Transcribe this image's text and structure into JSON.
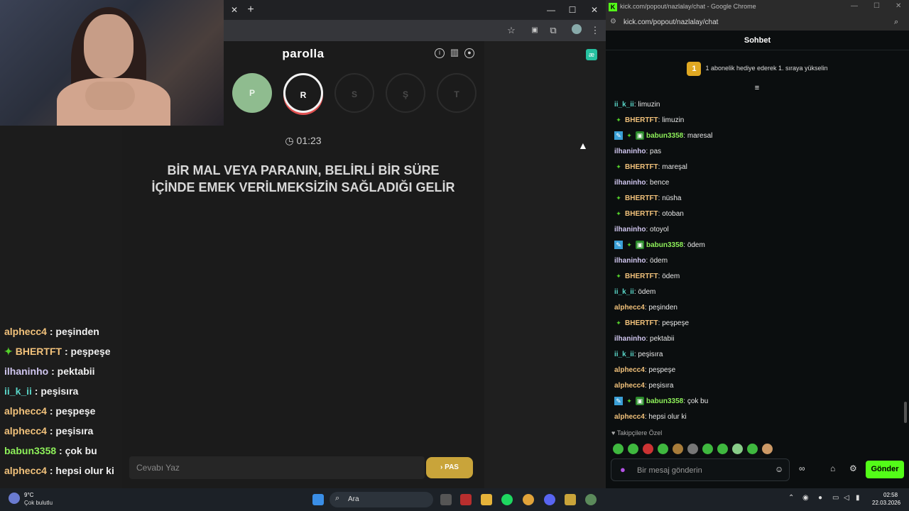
{
  "left_window": {
    "new_tab_symbol": "+",
    "controls": {
      "minimize": "—",
      "maximize": "☐",
      "close": "✕"
    }
  },
  "game": {
    "title": "parolla",
    "letters": [
      {
        "char": "P",
        "state": "done"
      },
      {
        "char": "R",
        "state": "active"
      },
      {
        "char": "S",
        "state": "pending"
      },
      {
        "char": "Ş",
        "state": "pending"
      },
      {
        "char": "T",
        "state": "pending"
      }
    ],
    "timer": "01:23",
    "question": "BİR MAL VEYA PARANIN, BELİRLİ BİR SÜRE İÇİNDE EMEK VERİLMEKSİZİN SAĞLADIĞI GELİR",
    "answer_placeholder": "Cevabı Yaz",
    "pas_label": "PAS"
  },
  "overlay_chat": [
    {
      "user": "alphecc4",
      "text": "peşinden",
      "color": "#f2c27b"
    },
    {
      "user": "BHERTFT",
      "text": "peşpeşe",
      "color": "#f2c27b",
      "badge": "✦"
    },
    {
      "user": "ilhaninho",
      "text": "pektabii",
      "color": "#d0c6ef"
    },
    {
      "user": "ii_k_ii",
      "text": "peşisıra",
      "color": "#5ad6c8"
    },
    {
      "user": "alphecc4",
      "text": "peşpeşe",
      "color": "#f2c27b"
    },
    {
      "user": "alphecc4",
      "text": "peşisıra",
      "color": "#f2c27b"
    },
    {
      "user": "babun3358",
      "text": "çok bu",
      "color": "#8ef05a"
    },
    {
      "user": "alphecc4",
      "text": "hepsi olur ki",
      "color": "#f2c27b"
    }
  ],
  "popup": {
    "window_title": "kick.com/popout/nazlalay/chat - Google Chrome",
    "url": "kick.com/popout/nazlalay/chat",
    "chat_title": "Sohbet",
    "gift_rank": "1",
    "gift_text": "1 abonelik hediye ederek 1. sıraya yükselin",
    "followers_only": "Takipçilere Özel",
    "input_placeholder": "Bir mesaj gönderin",
    "send_label": "Gönder",
    "messages": [
      {
        "user": "ii_k_ii",
        "text": "limuzin",
        "color": "#5ad6c8",
        "badges": []
      },
      {
        "user": "BHERTFT",
        "text": "limuzin",
        "color": "#f2c27b",
        "badges": [
          "green"
        ]
      },
      {
        "user": "babun3358",
        "text": "maresal",
        "color": "#8ef05a",
        "badges": [
          "blue",
          "green",
          "gift"
        ]
      },
      {
        "user": "ilhaninho",
        "text": "pas",
        "color": "#d0c6ef",
        "badges": []
      },
      {
        "user": "BHERTFT",
        "text": "mareşal",
        "color": "#f2c27b",
        "badges": [
          "green"
        ]
      },
      {
        "user": "ilhaninho",
        "text": "bence",
        "color": "#d0c6ef",
        "badges": []
      },
      {
        "user": "BHERTFT",
        "text": "nüsha",
        "color": "#f2c27b",
        "badges": [
          "green"
        ]
      },
      {
        "user": "BHERTFT",
        "text": "otoban",
        "color": "#f2c27b",
        "badges": [
          "green"
        ]
      },
      {
        "user": "ilhaninho",
        "text": "otoyol",
        "color": "#d0c6ef",
        "badges": []
      },
      {
        "user": "babun3358",
        "text": "ödem",
        "color": "#8ef05a",
        "badges": [
          "blue",
          "green",
          "gift"
        ]
      },
      {
        "user": "ilhaninho",
        "text": "ödem",
        "color": "#d0c6ef",
        "badges": []
      },
      {
        "user": "BHERTFT",
        "text": "ödem",
        "color": "#f2c27b",
        "badges": [
          "green"
        ]
      },
      {
        "user": "ii_k_ii",
        "text": "ödem",
        "color": "#5ad6c8",
        "badges": []
      },
      {
        "user": "alphecc4",
        "text": "peşinden",
        "color": "#f2c27b",
        "badges": []
      },
      {
        "user": "BHERTFT",
        "text": "peşpeşe",
        "color": "#f2c27b",
        "badges": [
          "green"
        ]
      },
      {
        "user": "ilhaninho",
        "text": "pektabii",
        "color": "#d0c6ef",
        "badges": []
      },
      {
        "user": "ii_k_ii",
        "text": "peşisıra",
        "color": "#5ad6c8",
        "badges": []
      },
      {
        "user": "alphecc4",
        "text": "peşpeşe",
        "color": "#f2c27b",
        "badges": []
      },
      {
        "user": "alphecc4",
        "text": "peşisıra",
        "color": "#f2c27b",
        "badges": []
      },
      {
        "user": "babun3358",
        "text": "çok bu",
        "color": "#8ef05a",
        "badges": [
          "blue",
          "green",
          "gift"
        ]
      },
      {
        "user": "alphecc4",
        "text": "hepsi olur ki",
        "color": "#f2c27b",
        "badges": []
      }
    ]
  },
  "taskbar": {
    "weather_temp": "9°C",
    "weather_desc": "Çok bulutlu",
    "search_label": "Ara",
    "time": "02:58",
    "date": "22.03.2026"
  },
  "colors": {
    "kick_green": "#53fc18",
    "pas_gold": "#c9a43a"
  }
}
